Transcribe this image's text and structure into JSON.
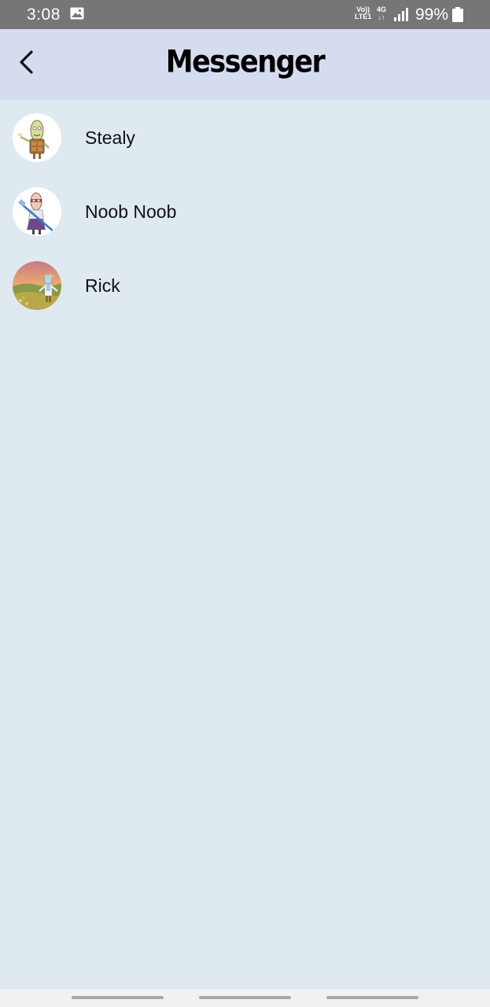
{
  "status_bar": {
    "time": "3:08",
    "volte_top": "Vo))",
    "volte_bottom": "LTE1",
    "network_type": "4G",
    "battery_percent": "99%",
    "icons": [
      "gallery-icon",
      "signal-icon",
      "battery-icon"
    ]
  },
  "app_bar": {
    "title": "Messenger",
    "back_icon": "chevron-left-icon",
    "background_color": "#d6dcf0"
  },
  "contacts": [
    {
      "name": "Stealy",
      "avatar": "stealy-avatar"
    },
    {
      "name": "Noob Noob",
      "avatar": "noob-noob-avatar"
    },
    {
      "name": "Rick",
      "avatar": "rick-avatar"
    }
  ],
  "colors": {
    "page_background": "#dfe9f0",
    "status_bar": "#767676",
    "nav_bar": "#f1f1f1"
  },
  "nav_bar": {
    "buttons": [
      "recents-button",
      "home-button",
      "back-nav-button"
    ]
  }
}
